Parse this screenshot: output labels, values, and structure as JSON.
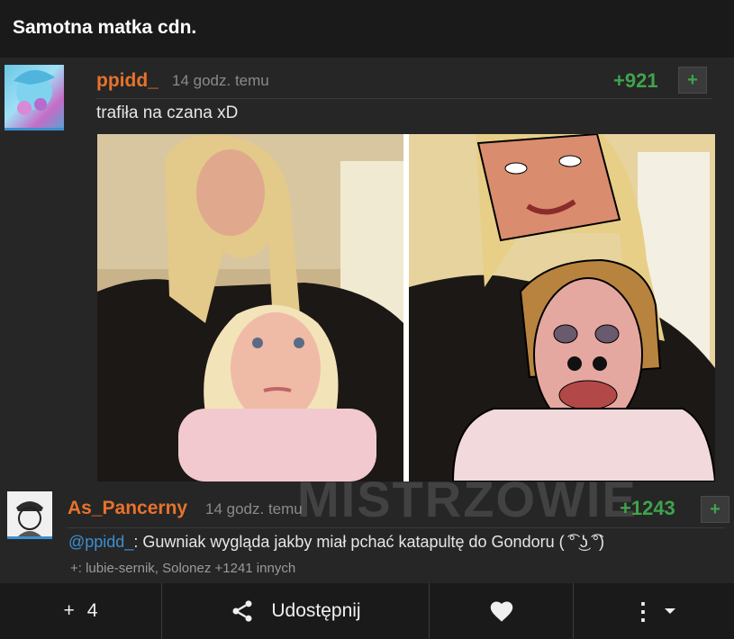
{
  "page": {
    "title": "Samotna matka cdn."
  },
  "comments": [
    {
      "username": "ppidd_",
      "time": "14 godz. temu",
      "score": "+921",
      "plus": "+",
      "text": "trafiła na czana xD"
    },
    {
      "username": "As_Pancerny",
      "time": "14 godz. temu",
      "score": "+1243",
      "plus": "+",
      "mention": "@ppidd_",
      "text": ": Guwniak wygląda jakby miał pchać katapultę do Gondoru ( ͡° ͜ʖ ͡°)",
      "voters": "+: lubie-sernik, Solonez +1241 innych"
    }
  ],
  "watermark": "MISTRZOWIE",
  "bottom_bar": {
    "plus_label": "+",
    "plus_count": "4",
    "share_label": "Udostępnij",
    "more_symbol": "⋮"
  },
  "colors": {
    "username": "#e8722c",
    "score": "#3fa34d",
    "link": "#3d8fd1",
    "background": "#262626",
    "bar": "#1a1a1a"
  }
}
